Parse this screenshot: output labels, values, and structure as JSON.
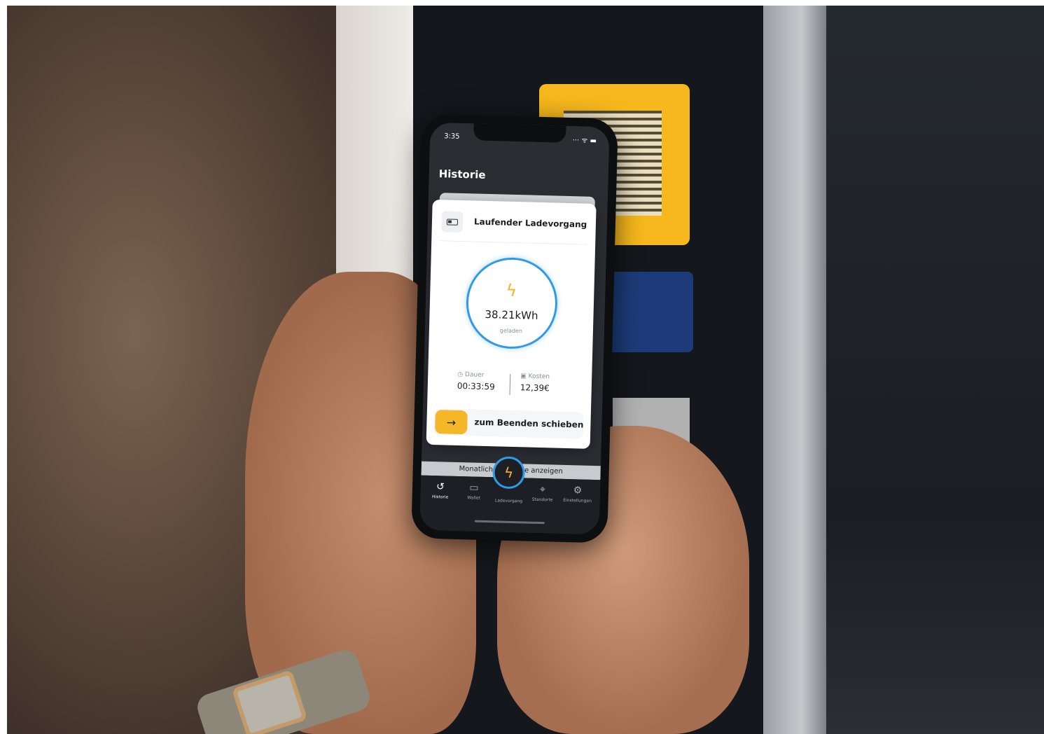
{
  "status_bar": {
    "time": "3:35",
    "icons": "··· ᯤ ▬"
  },
  "screen_title": "Historie",
  "card": {
    "title": "Laufender Ladevorgang",
    "energy": "38.21kWh",
    "energy_label": "geladen",
    "duration_label": "Dauer",
    "duration_value": "00:33:59",
    "cost_label": "Kosten",
    "cost_value": "12,39€",
    "slider_label": "zum Beenden schieben"
  },
  "behind_text": "Monatliche Berichte anzeigen",
  "tabs": [
    {
      "label": "Historie",
      "icon": "history-icon"
    },
    {
      "label": "Wallet",
      "icon": "wallet-icon"
    },
    {
      "label": "Ladevorgang",
      "icon": "bolt-icon"
    },
    {
      "label": "Standorte",
      "icon": "location-icon"
    },
    {
      "label": "Einstellungen",
      "icon": "gear-icon"
    }
  ],
  "colors": {
    "accent_yellow": "#f5b629",
    "accent_blue": "#2f9be6",
    "dark_bg": "#2b2d33"
  }
}
